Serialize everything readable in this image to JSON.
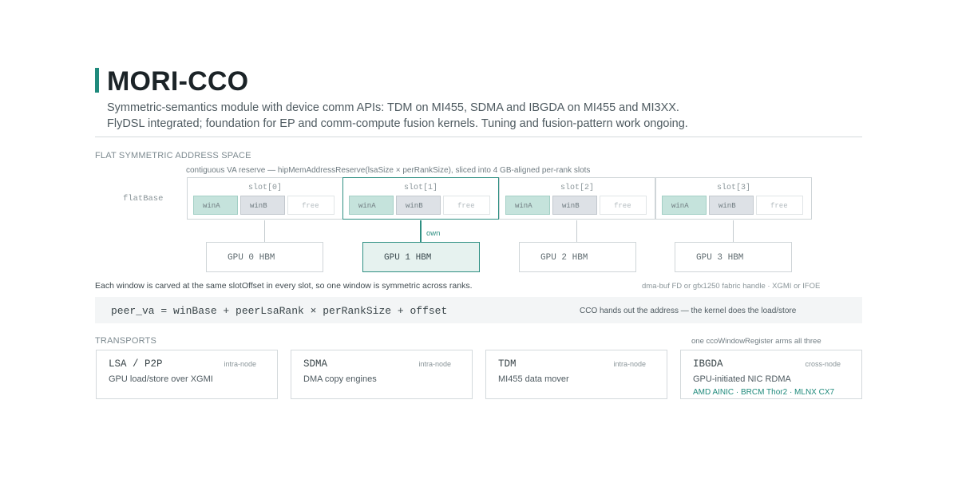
{
  "header": {
    "title": "MORI-CCO",
    "subtitle_lines": [
      "Symmetric-semantics module with device comm APIs: TDM on MI455, SDMA and IBGDA on MI455 and MI3XX.",
      "FlyDSL integrated; foundation for EP and comm-compute fusion kernels. Tuning and fusion-pattern work ongoing."
    ]
  },
  "address_space": {
    "section_label": "FLAT SYMMETRIC ADDRESS SPACE",
    "reserve_note": "contiguous VA reserve — hipMemAddressReserve(lsaSize × perRankSize), sliced into 4 GB-aligned per-rank slots",
    "base_label": "flatBase",
    "slots": [
      {
        "label": "slot[0]",
        "windows": [
          "winA",
          "winB",
          "free"
        ],
        "gpu": "GPU 0 HBM",
        "owned": false
      },
      {
        "label": "slot[1]",
        "windows": [
          "winA",
          "winB",
          "free"
        ],
        "gpu": "GPU 1 HBM",
        "owned": true
      },
      {
        "label": "slot[2]",
        "windows": [
          "winA",
          "winB",
          "free"
        ],
        "gpu": "GPU 2 HBM",
        "owned": false
      },
      {
        "label": "slot[3]",
        "windows": [
          "winA",
          "winB",
          "free"
        ],
        "gpu": "GPU 3 HBM",
        "owned": false
      }
    ],
    "own_label": "own",
    "window_note": "Each window is carved at the same slotOffset in every slot, so one window is symmetric across ranks.",
    "fabric_note": "dma-buf FD or gfx1250 fabric handle · XGMI or IFOE"
  },
  "formula": {
    "code": "peer_va = winBase + peerLsaRank × perRankSize + offset",
    "note": "CCO hands out the address — the kernel does the load/store"
  },
  "transports": {
    "section_label": "TRANSPORTS",
    "register_note": "one ccoWindowRegister arms all three",
    "cards": [
      {
        "title": "LSA / P2P",
        "scope": "intra-node",
        "desc": "GPU load/store over XGMI",
        "vendors": ""
      },
      {
        "title": "SDMA",
        "scope": "intra-node",
        "desc": "DMA copy engines",
        "vendors": ""
      },
      {
        "title": "TDM",
        "scope": "intra-node",
        "desc": "MI455 data mover",
        "vendors": ""
      },
      {
        "title": "IBGDA",
        "scope": "cross-node",
        "desc": "GPU-initiated NIC RDMA",
        "vendors": "AMD AINIC · BRCM Thor2 · MLNX CX7"
      }
    ]
  },
  "colors": {
    "accent": "#1f8a7c",
    "window_a": "#c5e3dc",
    "window_b": "#dde1e6",
    "owned_gpu_fill": "#e6f2ef"
  }
}
